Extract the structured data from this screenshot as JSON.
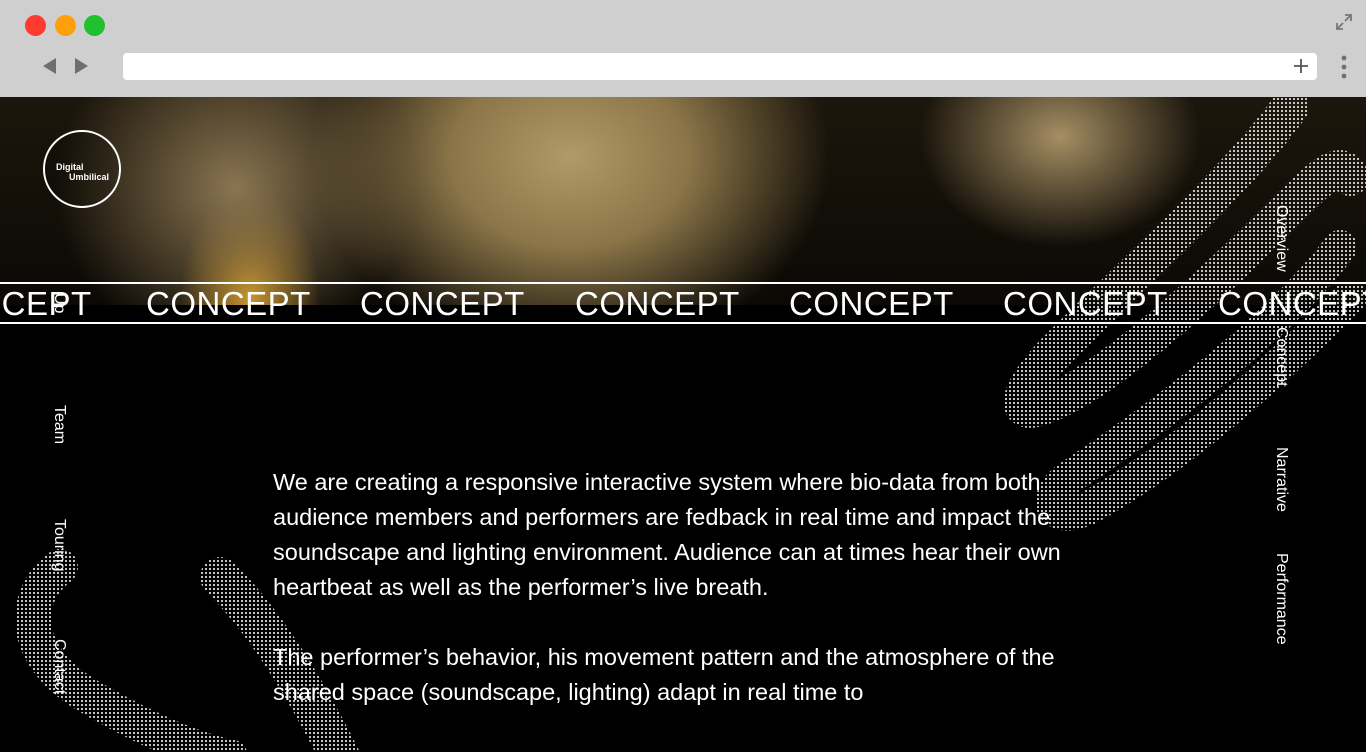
{
  "browser": {
    "url": "",
    "new_tab_icon": "plus-icon",
    "back_icon": "back-arrow-icon",
    "forward_icon": "forward-arrow-icon",
    "menu_icon": "kebab-menu-icon",
    "expand_icon": "expand-icon",
    "colors": {
      "close": "#ff3b30",
      "minimize": "#ff9f0a",
      "maximize": "#1fc12e"
    }
  },
  "logo": {
    "line1": "Digital",
    "line2": "Umbilical"
  },
  "band": {
    "words": [
      "ICEPT",
      "CONCEPT",
      "CONCEPT",
      "CONCEPT",
      "CONCEPT",
      "CONCEPT",
      "CONCEPT"
    ]
  },
  "left_nav": {
    "items": [
      {
        "label": "Up"
      },
      {
        "label": "Team"
      },
      {
        "label": "Touring"
      },
      {
        "label": "Contact"
      }
    ]
  },
  "right_nav": {
    "items": [
      {
        "label": "Overview"
      },
      {
        "label": "Concept"
      },
      {
        "label": "Narrative"
      },
      {
        "label": "Performance"
      }
    ]
  },
  "content": {
    "paragraph1": "We are creating a responsive interactive system where bio-data from both audience members and performers are fedback in real time and impact the soundscape and lighting environment. Audience can at times hear their own heartbeat as well as the performer’s live breath.",
    "paragraph2": "The performer’s behavior, his movement pattern and the atmosphere of the shared space (soundscape, lighting) adapt in real time to"
  }
}
